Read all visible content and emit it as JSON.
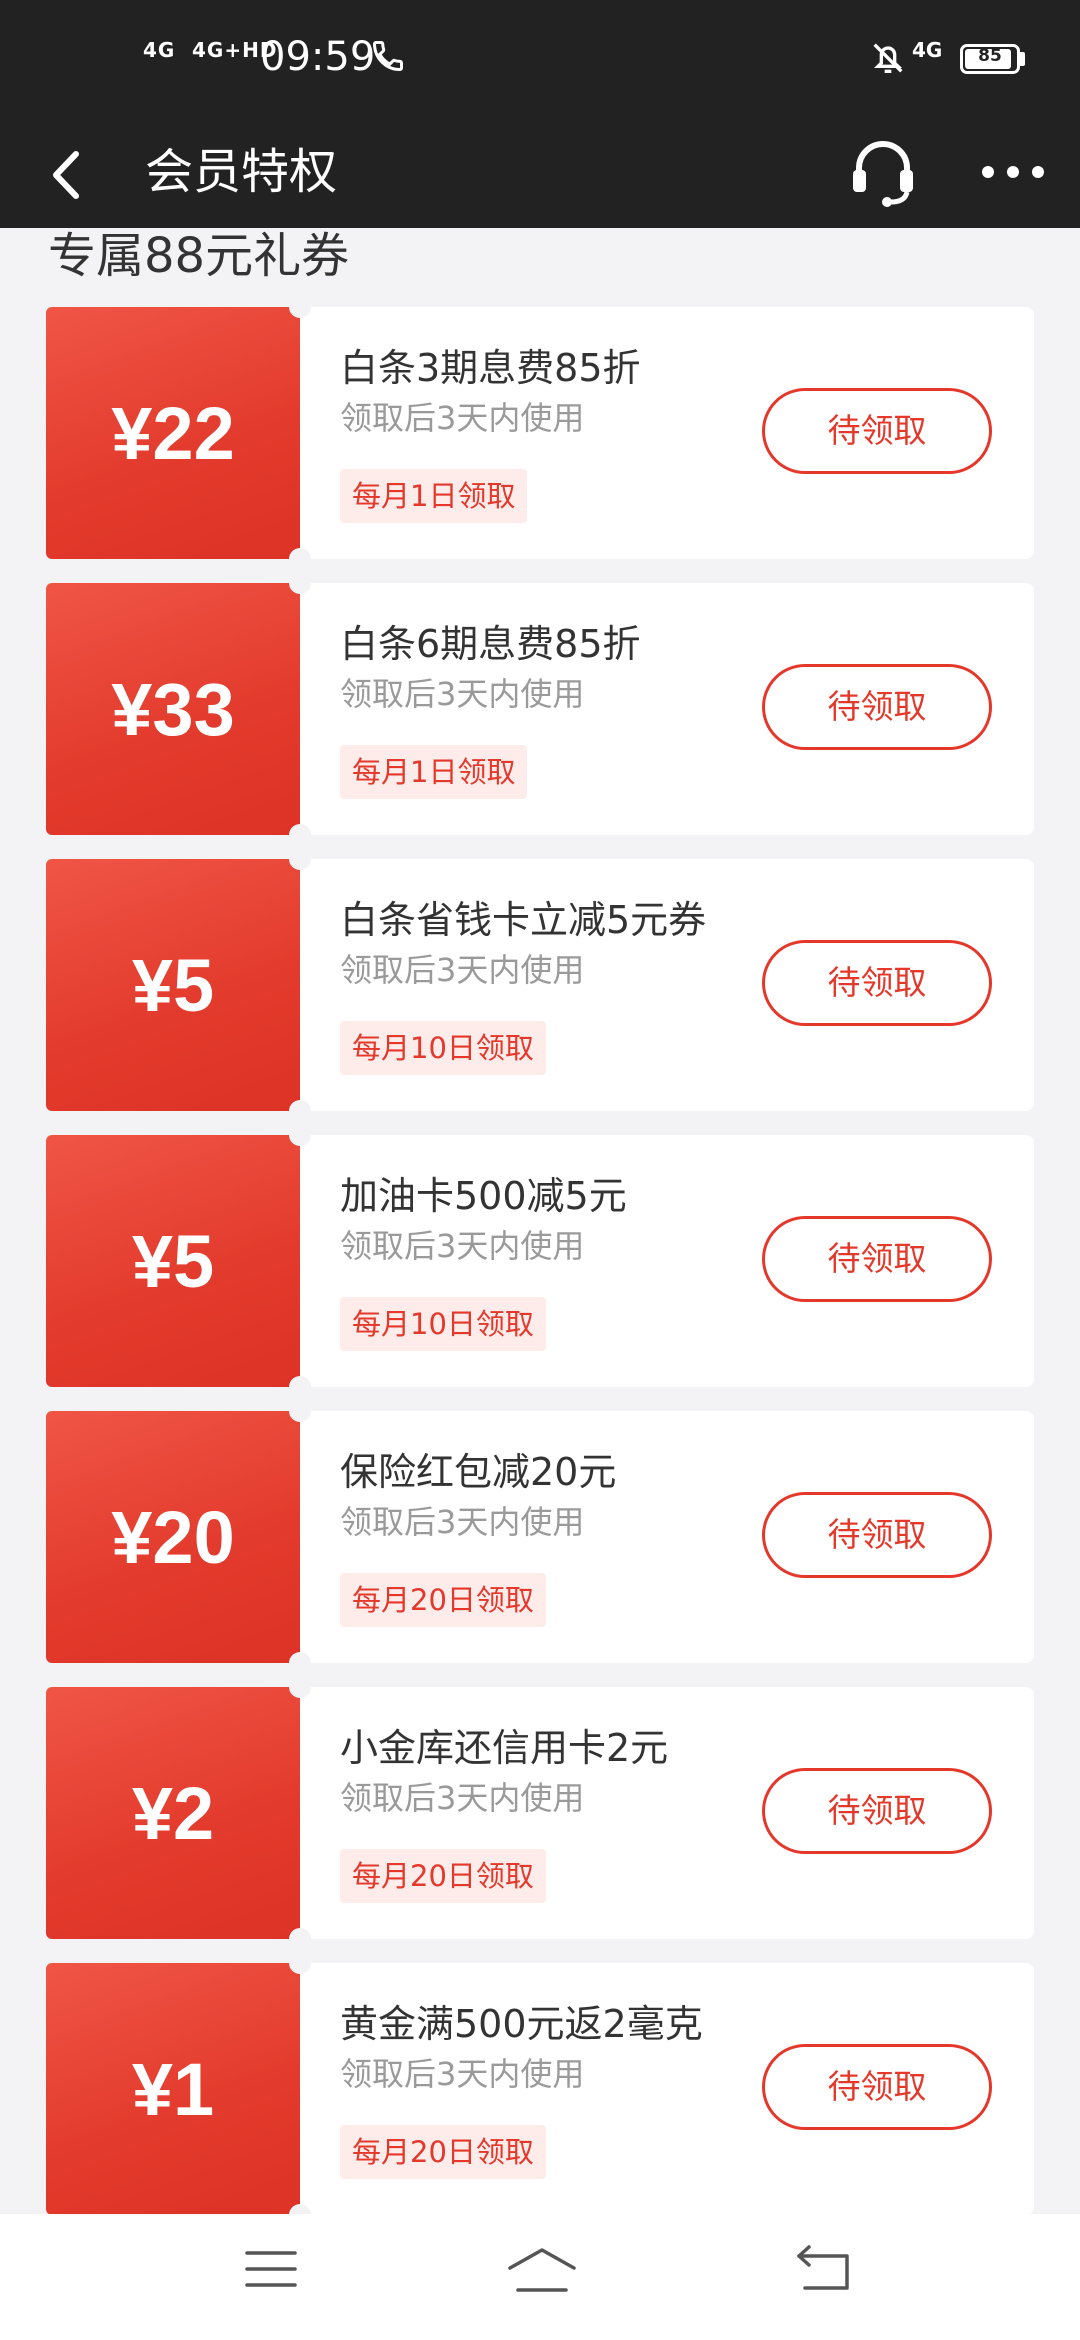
{
  "status_bar": {
    "network1": "4G",
    "network2": "4G+HD",
    "time": "09:59",
    "network3": "4G",
    "battery": "85",
    "battery_level": 0.85
  },
  "header": {
    "title": "会员特权",
    "icons": [
      "back-icon",
      "customer-service-icon",
      "more-icon"
    ]
  },
  "section": {
    "title": "专属88元礼券"
  },
  "colors": {
    "accent": "#e4382b",
    "header_bg": "#222222",
    "page_bg": "#f3f3f5"
  },
  "coupons": [
    {
      "amount": "¥22",
      "title": "白条3期息费85折",
      "desc": "领取后3天内使用",
      "tag": "每月1日领取",
      "button": "待领取"
    },
    {
      "amount": "¥33",
      "title": "白条6期息费85折",
      "desc": "领取后3天内使用",
      "tag": "每月1日领取",
      "button": "待领取"
    },
    {
      "amount": "¥5",
      "title": "白条省钱卡立减5元券",
      "desc": "领取后3天内使用",
      "tag": "每月10日领取",
      "button": "待领取"
    },
    {
      "amount": "¥5",
      "title": "加油卡500减5元",
      "desc": "领取后3天内使用",
      "tag": "每月10日领取",
      "button": "待领取"
    },
    {
      "amount": "¥20",
      "title": "保险红包减20元",
      "desc": "领取后3天内使用",
      "tag": "每月20日领取",
      "button": "待领取"
    },
    {
      "amount": "¥2",
      "title": "小金库还信用卡2元",
      "desc": "领取后3天内使用",
      "tag": "每月20日领取",
      "button": "待领取"
    },
    {
      "amount": "¥1",
      "title": "黄金满500元返2毫克",
      "desc": "领取后3天内使用",
      "tag": "每月20日领取",
      "button": "待领取"
    }
  ],
  "nav_bar": {
    "icons": [
      "menu-icon",
      "home-icon",
      "back-nav-icon"
    ]
  }
}
